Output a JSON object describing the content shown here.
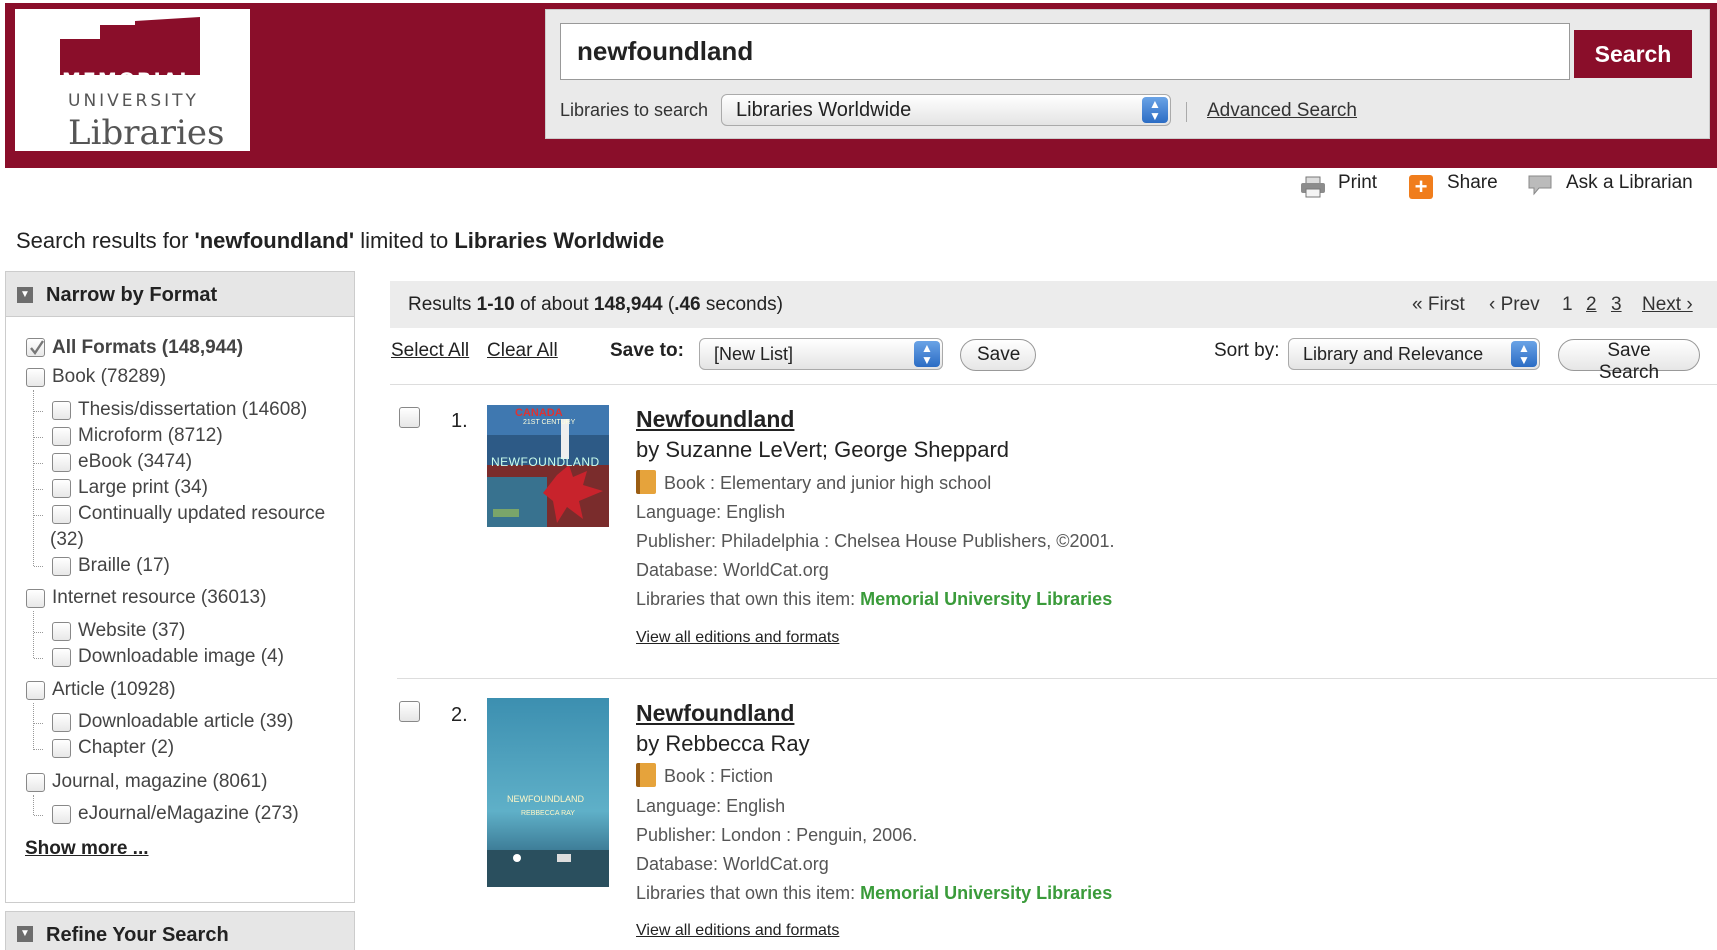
{
  "header": {
    "logo": {
      "line1": "MEMORIAL",
      "line2": "UNIVERSITY",
      "line3": "Libraries"
    },
    "search": {
      "query": "newfoundland",
      "button": "Search",
      "libraries_label": "Libraries to search",
      "libraries_value": "Libraries Worldwide",
      "advanced": "Advanced Search"
    }
  },
  "tools": {
    "print": "Print",
    "share": "Share",
    "ask": "Ask a Librarian"
  },
  "heading": {
    "prefix": "Search results for ",
    "query": "'newfoundland'",
    "middle": " limited to ",
    "scope": "Libraries Worldwide"
  },
  "sidebar": {
    "narrow_title": "Narrow by Format",
    "refine_title": "Refine Your Search",
    "show_more": "Show more ...",
    "formats": [
      "All Formats (148,944)",
      "Book (78289)",
      "Thesis/dissertation (14608)",
      "Microform (8712)",
      "eBook (3474)",
      "Large print (34)",
      "Continually updated resource",
      "(32)",
      "Braille (17)",
      "Internet resource (36013)",
      "Website (37)",
      "Downloadable image (4)",
      "Article (10928)",
      "Downloadable article (39)",
      "Chapter (2)",
      "Journal, magazine (8061)",
      "eJournal/eMagazine (273)"
    ]
  },
  "results_bar": {
    "results_word": "Results ",
    "range": "1-10",
    "of_about": " of about ",
    "total": "148,944",
    "open": " (",
    "seconds": ".46",
    "close": " seconds)",
    "first": "« First",
    "prev": "‹ Prev",
    "pages": [
      "1",
      "2",
      "3"
    ],
    "next": "Next ›"
  },
  "toolbar": {
    "select_all": "Select All",
    "clear_all": "Clear All",
    "save_to_label": "Save to:",
    "save_to_value": "[New List]",
    "save_button": "Save",
    "sort_label": "Sort by:",
    "sort_value": "Library and Relevance",
    "save_search": "Save Search"
  },
  "results": [
    {
      "num": "1.",
      "title": "Newfoundland",
      "author": "by Suzanne LeVert; George Sheppard",
      "format": "Book : Elementary and junior high school",
      "language": "Language: English",
      "publisher": "Publisher: Philadelphia : Chelsea House Publishers, ©2001.",
      "database": "Database: WorldCat.org",
      "libraries_label": "Libraries that own this item: ",
      "libraries_value": "Memorial University Libraries",
      "view_all": "View all editions and formats",
      "cover_text": [
        "CANADA",
        "21ST CENTURY",
        "NEWFOUNDLAND"
      ]
    },
    {
      "num": "2.",
      "title": "Newfoundland",
      "author": "by Rebbecca Ray",
      "format": "Book : Fiction",
      "language": "Language: English",
      "publisher": "Publisher: London : Penguin, 2006.",
      "database": "Database: WorldCat.org",
      "libraries_label": "Libraries that own this item: ",
      "libraries_value": "Memorial University Libraries",
      "view_all": "View all editions and formats",
      "cover_text": [
        "NEWFOUNDLAND",
        "REBBECCA RAY"
      ]
    }
  ],
  "colors": {
    "brand": "#8a0e2a",
    "link_green": "#3a9b3a",
    "share": "#f07d1c"
  }
}
